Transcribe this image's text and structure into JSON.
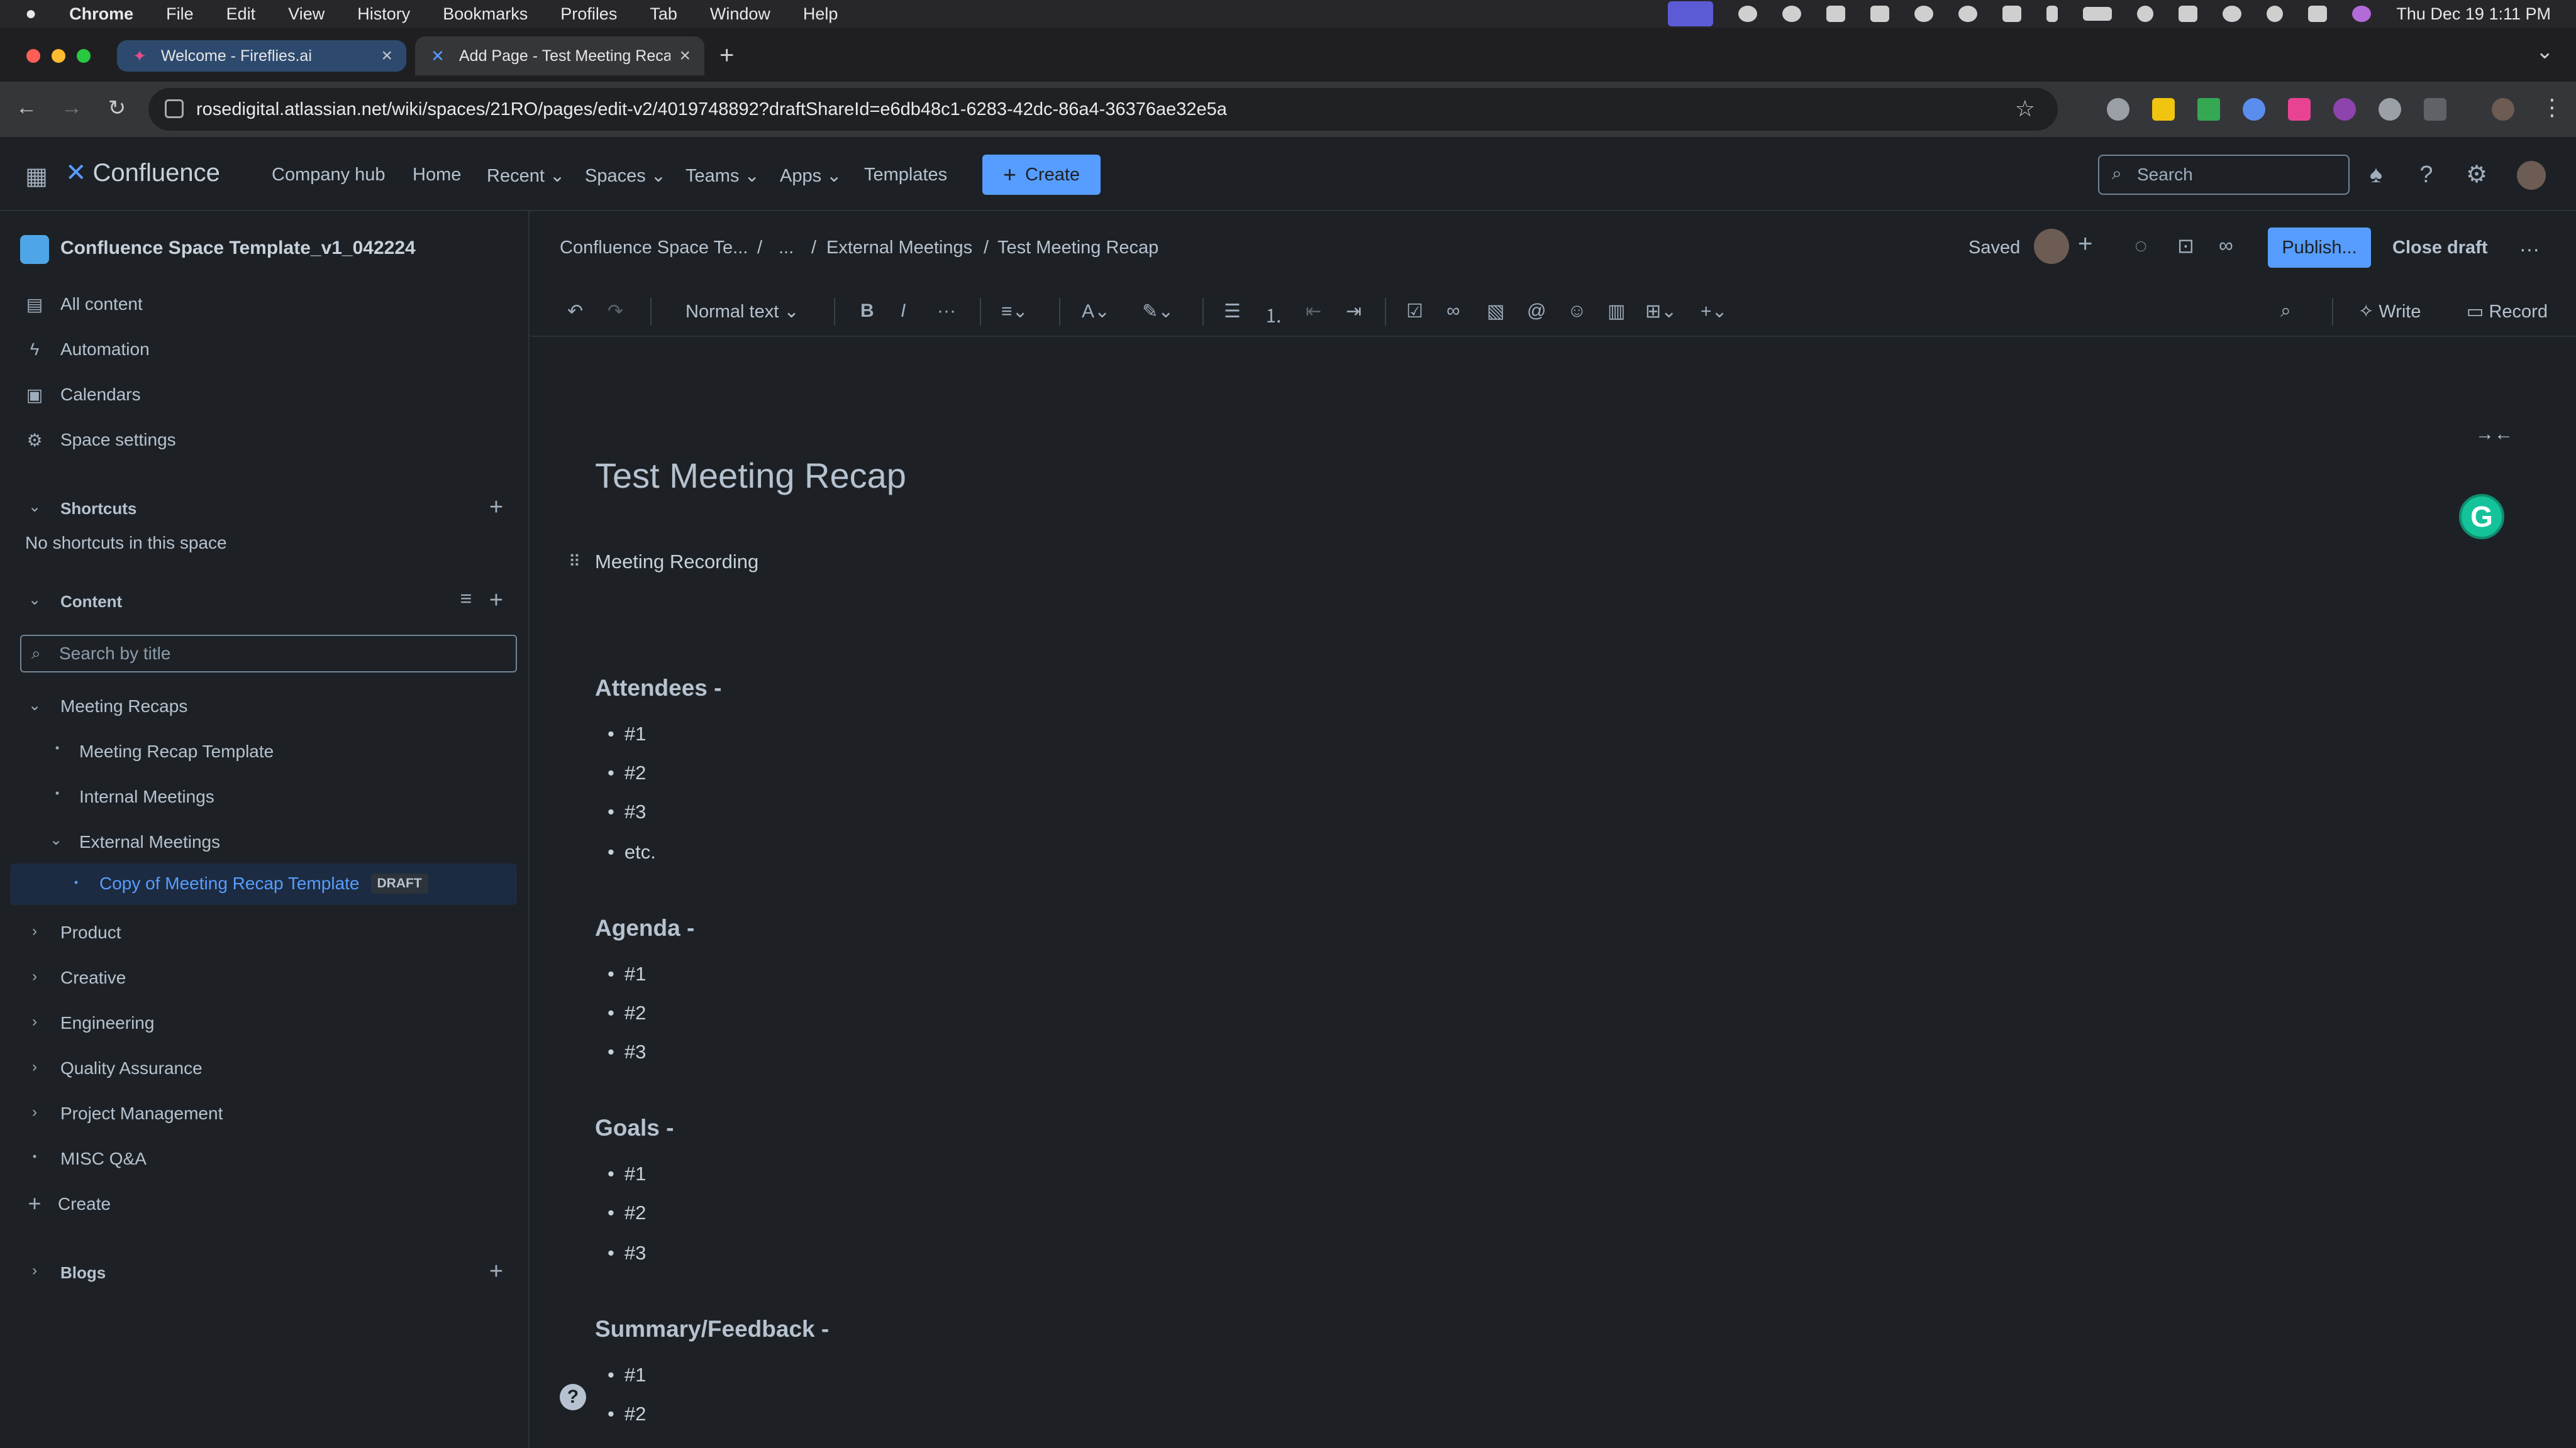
{
  "menubar": {
    "apple": "",
    "app": "Chrome",
    "items": [
      "File",
      "Edit",
      "View",
      "History",
      "Bookmarks",
      "Profiles",
      "Tab",
      "Window",
      "Help"
    ],
    "datetime": "Thu Dec 19  1:11 PM"
  },
  "tabs": [
    {
      "title": "Welcome - Fireflies.ai",
      "close": "×"
    },
    {
      "title": "Add Page - Test Meeting Recap",
      "close": "×"
    }
  ],
  "new_tab": "+",
  "browser": {
    "url": "rosedigital.atlassian.net/wiki/spaces/21RO/pages/edit-v2/4019748892?draftShareId=e6db48c1-6283-42dc-86a4-36376ae32e5a",
    "back": "←",
    "forward": "→",
    "reload": "↻",
    "star": "☆",
    "menu": "⋮",
    "tabs_dropdown": "⌄"
  },
  "topnav": {
    "logo": "Confluence",
    "items": [
      "Company hub",
      "Home",
      "Recent ⌄",
      "Spaces ⌄",
      "Teams ⌄",
      "Apps ⌄",
      "Templates"
    ],
    "create_label": "Create",
    "search_placeholder": "Search"
  },
  "sidebar": {
    "space_name": "Confluence Space Template_v1_042224",
    "items": [
      "All content",
      "Automation",
      "Calendars",
      "Space settings"
    ],
    "shortcuts_heading": "Shortcuts",
    "no_shortcuts": "No shortcuts in this space",
    "content_heading": "Content",
    "search_placeholder": "Search by title",
    "tree": {
      "meeting_recaps": "Meeting Recaps",
      "recap_template": "Meeting Recap Template",
      "internal": "Internal Meetings",
      "external": "External Meetings",
      "copy": "Copy of Meeting Recap Template",
      "draft": "DRAFT",
      "others": [
        "Product",
        "Creative",
        "Engineering",
        "Quality Assurance",
        "Project Management",
        "MISC Q&A"
      ]
    },
    "create": "Create",
    "blogs": "Blogs"
  },
  "editor": {
    "breadcrumbs": [
      "Confluence Space Te...",
      "...",
      "External Meetings",
      "Test Meeting Recap"
    ],
    "separator": "/",
    "saved": "Saved",
    "publish": "Publish...",
    "close_draft": "Close draft",
    "more": "···",
    "text_style": "Normal text",
    "write": "Write",
    "record": "Record"
  },
  "doc": {
    "title": "Test Meeting Recap",
    "recording": "Meeting Recording",
    "attendees_heading": "Attendees -",
    "attendees": [
      "#1",
      "#2",
      "#3",
      "etc."
    ],
    "agenda_heading": "Agenda -",
    "agenda": [
      "#1",
      "#2",
      "#3"
    ],
    "goals_heading": "Goals -",
    "goals": [
      "#1",
      "#2",
      "#3"
    ],
    "summary_heading": "Summary/Feedback -",
    "summary": [
      "#1",
      "#2"
    ]
  },
  "grammarly": "G"
}
